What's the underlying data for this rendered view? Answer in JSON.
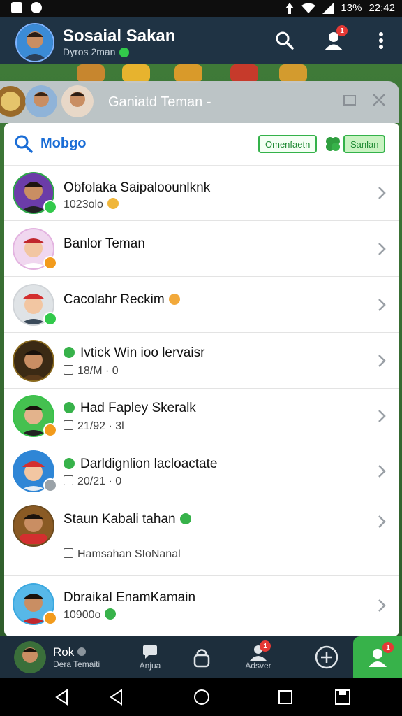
{
  "status_bar": {
    "battery_text": "13%",
    "time": "22:42"
  },
  "header": {
    "title": "Sosaial Sakan",
    "subtitle": "Dyros 2man",
    "notif_badge": "1"
  },
  "sub_header": {
    "title": "Ganiatd Teman -"
  },
  "search": {
    "text": "Mobgo",
    "chip1": "Omenfaetn",
    "chip2": "Sanlan"
  },
  "friends": [
    {
      "name": "Obfolaka Saipaloounlknk",
      "meta": "1023olo",
      "status": "#32c94b"
    },
    {
      "name": "Banlor Teman",
      "meta": "",
      "status": "#f29b1c"
    },
    {
      "name": "Cacolahr Reckim",
      "meta": "",
      "status": "#32c94b"
    },
    {
      "name": "Ivtick Win ioo lervaisr",
      "meta": "18/M · 0",
      "status": ""
    },
    {
      "name": "Had Fapley Skeralk",
      "meta": "21/92 · 3l",
      "status": "#f29b1c"
    },
    {
      "name": "Darldignlion lacloactate",
      "meta": "20/21 · 0",
      "status": "#9aa2a8"
    },
    {
      "name": "Staun Kabali tahan",
      "meta": "Hamsahan SIoNanal",
      "status": ""
    },
    {
      "name": "Dbraikal EnamKamain",
      "meta": "10900o",
      "status": "#f29b1c"
    }
  ],
  "bottom_nav": {
    "profile_name": "Rok",
    "profile_sub": "Dera Temaiti",
    "chat_label": "Anjua",
    "lock_label": "",
    "admin_label": "Adsver",
    "admin_badge": "1",
    "friends_badge": "1"
  },
  "colors": {
    "accent_green": "#37b24a",
    "header_bg": "#1f3344",
    "link_blue": "#1a6dd6"
  }
}
